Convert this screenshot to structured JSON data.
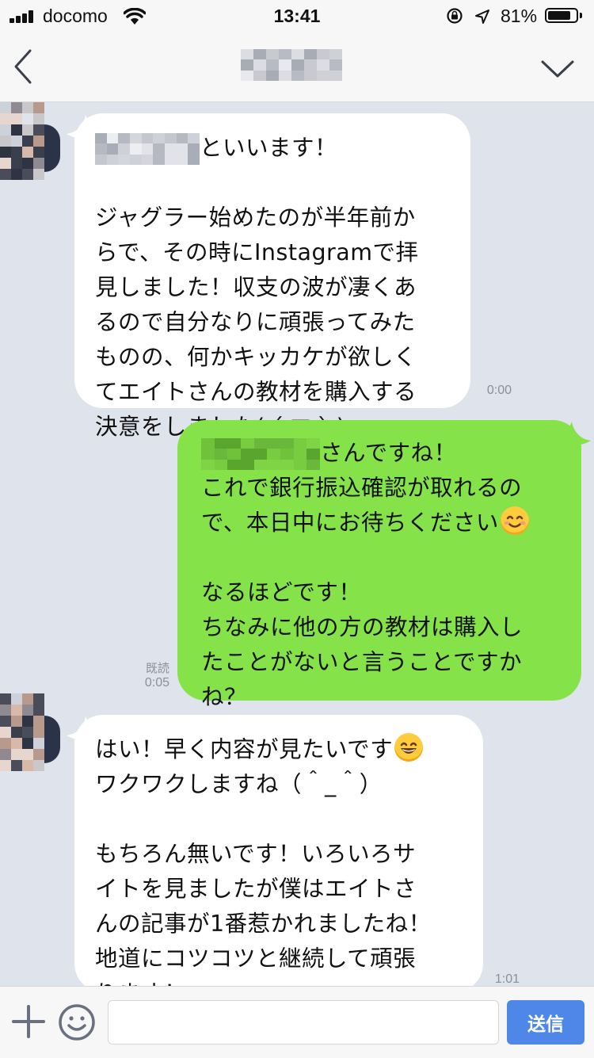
{
  "status_bar": {
    "carrier": "docomo",
    "time": "13:41",
    "battery_percent": "81%",
    "battery_level": 0.81
  },
  "header": {
    "back_icon": "chevron-left-icon",
    "collapse_icon": "chevron-down-icon"
  },
  "messages": [
    {
      "direction": "incoming",
      "text_after_name": "といいます！\n\nジャグラー始めたのが半年前か\nらで、その時にInstagramで拝\n見しました！収支の波が凄くあ\nるので自分なりに頑張ってみた\nものの、何かキッカケが欲しく\nてエイトさんの教材を購入する\n決意をしました( ´ ▽ ` )",
      "time": "0:00"
    },
    {
      "direction": "outgoing",
      "text_after_name": "さんですね！\nこれで銀行振込確認が取れるの\nで、本日中にお待ちください",
      "text_2": "なるほどです！\nちなみに他の方の教材は購入し\nたことがないと言うことですか\nね？",
      "read_label": "既読",
      "time": "0:05",
      "emoji": "smiling-face-icon"
    },
    {
      "direction": "incoming",
      "line_1": "はい！早く内容が見たいです",
      "text_2": "ワクワクしますね（＾_＾）\n\nもちろん無いです！いろいろサ\nイトを見ましたが僕はエイトさ\nんの記事が1番惹かれましたね！\n地道にコツコツと継続して頑張\nります！",
      "time": "1:01",
      "emoji": "grinning-face-icon"
    }
  ],
  "input_bar": {
    "placeholder": "",
    "send_label": "送信",
    "plus_icon": "plus-icon",
    "sticker_icon": "emoji-icon"
  },
  "colors": {
    "background": "#dfe3ec",
    "incoming_bubble": "#ffffff",
    "outgoing_bubble": "#85e249",
    "send_button": "#4f87e8"
  }
}
